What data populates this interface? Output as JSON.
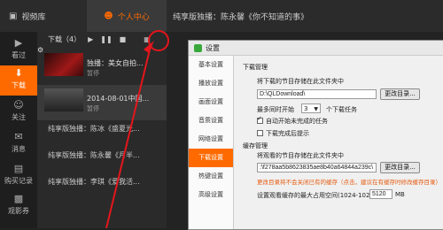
{
  "header": {
    "tab_video": "视频库",
    "tab_me": "个人中心",
    "now_playing": "纯享版独播：陈永馨《你不知道的事》"
  },
  "sidebar": {
    "items": [
      {
        "label": "看过"
      },
      {
        "label": "下载"
      },
      {
        "label": "关注"
      },
      {
        "label": "消息"
      },
      {
        "label": "购买记录"
      },
      {
        "label": "观影券"
      }
    ]
  },
  "download_list": {
    "header_label": "下载（4）",
    "items": [
      {
        "title": "独播：美女自拍...",
        "sub": "暂停"
      },
      {
        "title": "2014-08-01中国...",
        "sub": "暂停"
      }
    ],
    "rows": [
      "纯享版独播：陈冰《盛夏光...",
      "纯享版独播：陈永馨《月半...",
      "纯享版独播：李琪《爱我活..."
    ]
  },
  "dialog": {
    "title": "设置",
    "nav": [
      "基本设置",
      "播放设置",
      "画面设置",
      "音质设置",
      "网络设置",
      "下载设置",
      "热键设置",
      "高级设置"
    ],
    "active_nav": "下载设置",
    "download_section": "下载管理",
    "save_path_label": "将下载的节目存储在此文件夹中",
    "save_path_value": "D:\\QLDownload\\",
    "change_dir_button": "更改目录...",
    "max_tasks_prefix": "最多同时开始",
    "max_tasks_value": "3",
    "max_tasks_suffix": "个下载任务",
    "auto_start_label": "自动开始未完成的任务",
    "auto_start_checked": true,
    "complete_tip_label": "下载完成后提示",
    "complete_tip_checked": false,
    "cache_section": "缓存管理",
    "cache_path_label": "将观看的节目存储在此文件夹中",
    "cache_path_value": ":\\f278aa5b8623835ae8b40a64844a239c\\",
    "change_dir_button2": "更改目录...",
    "cache_warn": "更改目录将不会关闭已有的缓存（点击，建议在有缓存时修改缓存目录）",
    "cache_size_label": "设置观看缓存的最大占用空间(1024-10240)",
    "cache_size_value": "5120",
    "cache_size_unit": "MB"
  }
}
